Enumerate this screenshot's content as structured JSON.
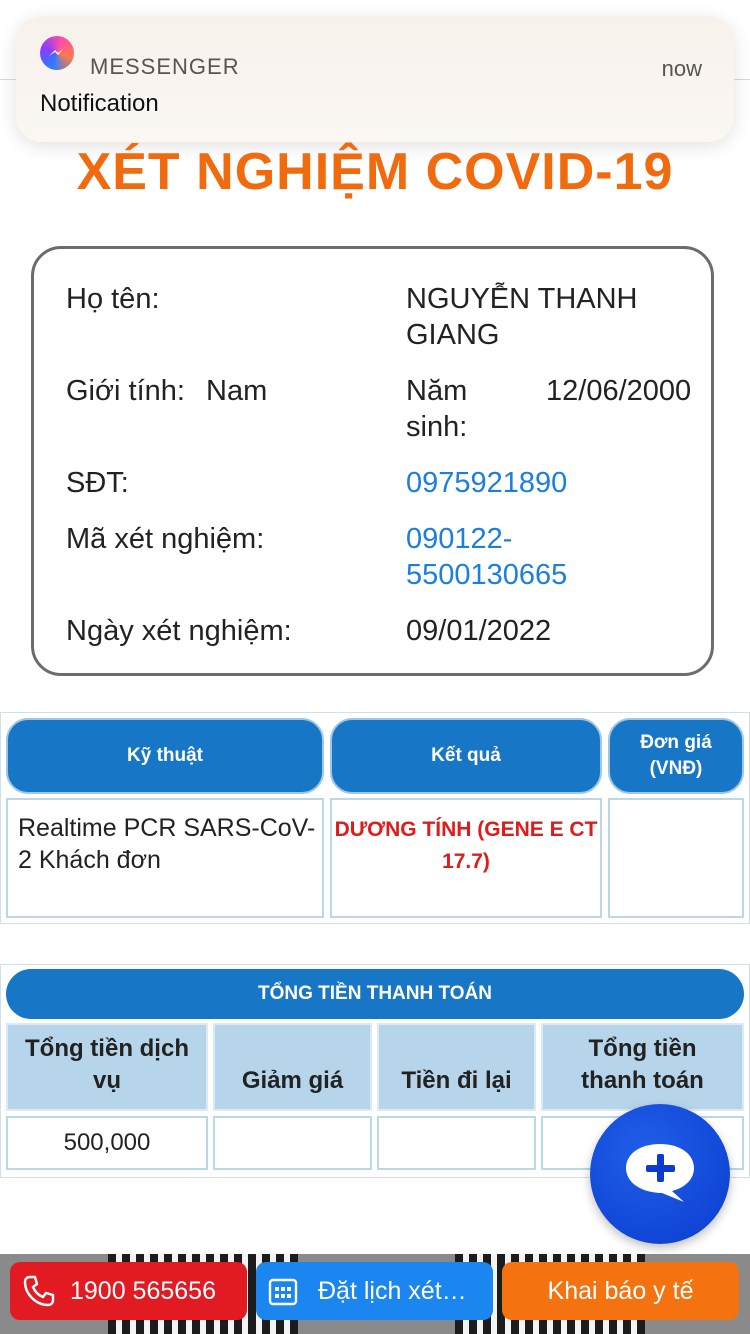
{
  "notification": {
    "app": "MESSENGER",
    "time": "now",
    "body": "Notification",
    "icon": "messenger-icon"
  },
  "page": {
    "title": "XÉT NGHIỆM COVID-19"
  },
  "info": {
    "name_label": "Họ tên:",
    "name_value_line1": "NGUYỄN THANH",
    "name_value_line2": "GIANG",
    "gender_label": "Giới tính:",
    "gender_value": "Nam",
    "birth_label_line1": "Năm",
    "birth_label_line2": "sinh:",
    "birth_value": "12/06/2000",
    "phone_label": "SĐT:",
    "phone_value": "0975921890",
    "code_label": "Mã xét nghiệm:",
    "code_value_line1": "090122-",
    "code_value_line2": "5500130665",
    "date_label": "Ngày xét nghiệm:",
    "date_value": "09/01/2022"
  },
  "results": {
    "headers": [
      "Kỹ thuật",
      "Kết quả",
      "Đơn giá (VNĐ)"
    ],
    "row": {
      "technique_line1": "Realtime PCR SARS-CoV-",
      "technique_line2": "2 Khách đơn",
      "result_line1": "DƯƠNG TÍNH (GENE E CT",
      "result_line2": "17.7)",
      "price": ""
    }
  },
  "payment": {
    "title": "TỔNG TIỀN THANH TOÁN",
    "headers": [
      "Tổng tiền dịch vụ",
      "Giảm giá",
      "Tiền đi lại",
      "Tổng tiền thanh toán"
    ],
    "values": [
      "500,000",
      "",
      "",
      ""
    ]
  },
  "bottom_bar": {
    "call_label": "1900 565656",
    "book_label": "Đặt lịch xét…",
    "declare_label": "Khai báo y tế"
  },
  "colors": {
    "accent": "#f26a0e",
    "primary": "#1876c6",
    "link": "#1a7fe0",
    "alert": "#e01b1b"
  }
}
